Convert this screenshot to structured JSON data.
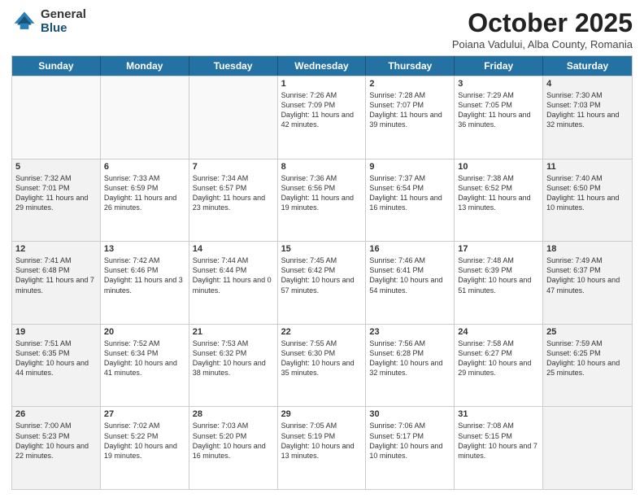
{
  "header": {
    "logo_general": "General",
    "logo_blue": "Blue",
    "month_title": "October 2025",
    "subtitle": "Poiana Vadului, Alba County, Romania"
  },
  "days_of_week": [
    "Sunday",
    "Monday",
    "Tuesday",
    "Wednesday",
    "Thursday",
    "Friday",
    "Saturday"
  ],
  "rows": [
    [
      {
        "day": "",
        "info": "",
        "empty": true
      },
      {
        "day": "",
        "info": "",
        "empty": true
      },
      {
        "day": "",
        "info": "",
        "empty": true
      },
      {
        "day": "1",
        "info": "Sunrise: 7:26 AM\nSunset: 7:09 PM\nDaylight: 11 hours and 42 minutes.",
        "empty": false
      },
      {
        "day": "2",
        "info": "Sunrise: 7:28 AM\nSunset: 7:07 PM\nDaylight: 11 hours and 39 minutes.",
        "empty": false
      },
      {
        "day": "3",
        "info": "Sunrise: 7:29 AM\nSunset: 7:05 PM\nDaylight: 11 hours and 36 minutes.",
        "empty": false
      },
      {
        "day": "4",
        "info": "Sunrise: 7:30 AM\nSunset: 7:03 PM\nDaylight: 11 hours and 32 minutes.",
        "empty": false,
        "shaded": true
      }
    ],
    [
      {
        "day": "5",
        "info": "Sunrise: 7:32 AM\nSunset: 7:01 PM\nDaylight: 11 hours and 29 minutes.",
        "empty": false,
        "shaded": true
      },
      {
        "day": "6",
        "info": "Sunrise: 7:33 AM\nSunset: 6:59 PM\nDaylight: 11 hours and 26 minutes.",
        "empty": false
      },
      {
        "day": "7",
        "info": "Sunrise: 7:34 AM\nSunset: 6:57 PM\nDaylight: 11 hours and 23 minutes.",
        "empty": false
      },
      {
        "day": "8",
        "info": "Sunrise: 7:36 AM\nSunset: 6:56 PM\nDaylight: 11 hours and 19 minutes.",
        "empty": false
      },
      {
        "day": "9",
        "info": "Sunrise: 7:37 AM\nSunset: 6:54 PM\nDaylight: 11 hours and 16 minutes.",
        "empty": false
      },
      {
        "day": "10",
        "info": "Sunrise: 7:38 AM\nSunset: 6:52 PM\nDaylight: 11 hours and 13 minutes.",
        "empty": false
      },
      {
        "day": "11",
        "info": "Sunrise: 7:40 AM\nSunset: 6:50 PM\nDaylight: 11 hours and 10 minutes.",
        "empty": false,
        "shaded": true
      }
    ],
    [
      {
        "day": "12",
        "info": "Sunrise: 7:41 AM\nSunset: 6:48 PM\nDaylight: 11 hours and 7 minutes.",
        "empty": false,
        "shaded": true
      },
      {
        "day": "13",
        "info": "Sunrise: 7:42 AM\nSunset: 6:46 PM\nDaylight: 11 hours and 3 minutes.",
        "empty": false
      },
      {
        "day": "14",
        "info": "Sunrise: 7:44 AM\nSunset: 6:44 PM\nDaylight: 11 hours and 0 minutes.",
        "empty": false
      },
      {
        "day": "15",
        "info": "Sunrise: 7:45 AM\nSunset: 6:42 PM\nDaylight: 10 hours and 57 minutes.",
        "empty": false
      },
      {
        "day": "16",
        "info": "Sunrise: 7:46 AM\nSunset: 6:41 PM\nDaylight: 10 hours and 54 minutes.",
        "empty": false
      },
      {
        "day": "17",
        "info": "Sunrise: 7:48 AM\nSunset: 6:39 PM\nDaylight: 10 hours and 51 minutes.",
        "empty": false
      },
      {
        "day": "18",
        "info": "Sunrise: 7:49 AM\nSunset: 6:37 PM\nDaylight: 10 hours and 47 minutes.",
        "empty": false,
        "shaded": true
      }
    ],
    [
      {
        "day": "19",
        "info": "Sunrise: 7:51 AM\nSunset: 6:35 PM\nDaylight: 10 hours and 44 minutes.",
        "empty": false,
        "shaded": true
      },
      {
        "day": "20",
        "info": "Sunrise: 7:52 AM\nSunset: 6:34 PM\nDaylight: 10 hours and 41 minutes.",
        "empty": false
      },
      {
        "day": "21",
        "info": "Sunrise: 7:53 AM\nSunset: 6:32 PM\nDaylight: 10 hours and 38 minutes.",
        "empty": false
      },
      {
        "day": "22",
        "info": "Sunrise: 7:55 AM\nSunset: 6:30 PM\nDaylight: 10 hours and 35 minutes.",
        "empty": false
      },
      {
        "day": "23",
        "info": "Sunrise: 7:56 AM\nSunset: 6:28 PM\nDaylight: 10 hours and 32 minutes.",
        "empty": false
      },
      {
        "day": "24",
        "info": "Sunrise: 7:58 AM\nSunset: 6:27 PM\nDaylight: 10 hours and 29 minutes.",
        "empty": false
      },
      {
        "day": "25",
        "info": "Sunrise: 7:59 AM\nSunset: 6:25 PM\nDaylight: 10 hours and 25 minutes.",
        "empty": false,
        "shaded": true
      }
    ],
    [
      {
        "day": "26",
        "info": "Sunrise: 7:00 AM\nSunset: 5:23 PM\nDaylight: 10 hours and 22 minutes.",
        "empty": false,
        "shaded": true
      },
      {
        "day": "27",
        "info": "Sunrise: 7:02 AM\nSunset: 5:22 PM\nDaylight: 10 hours and 19 minutes.",
        "empty": false
      },
      {
        "day": "28",
        "info": "Sunrise: 7:03 AM\nSunset: 5:20 PM\nDaylight: 10 hours and 16 minutes.",
        "empty": false
      },
      {
        "day": "29",
        "info": "Sunrise: 7:05 AM\nSunset: 5:19 PM\nDaylight: 10 hours and 13 minutes.",
        "empty": false
      },
      {
        "day": "30",
        "info": "Sunrise: 7:06 AM\nSunset: 5:17 PM\nDaylight: 10 hours and 10 minutes.",
        "empty": false
      },
      {
        "day": "31",
        "info": "Sunrise: 7:08 AM\nSunset: 5:15 PM\nDaylight: 10 hours and 7 minutes.",
        "empty": false
      },
      {
        "day": "",
        "info": "",
        "empty": true,
        "shaded": true
      }
    ]
  ]
}
